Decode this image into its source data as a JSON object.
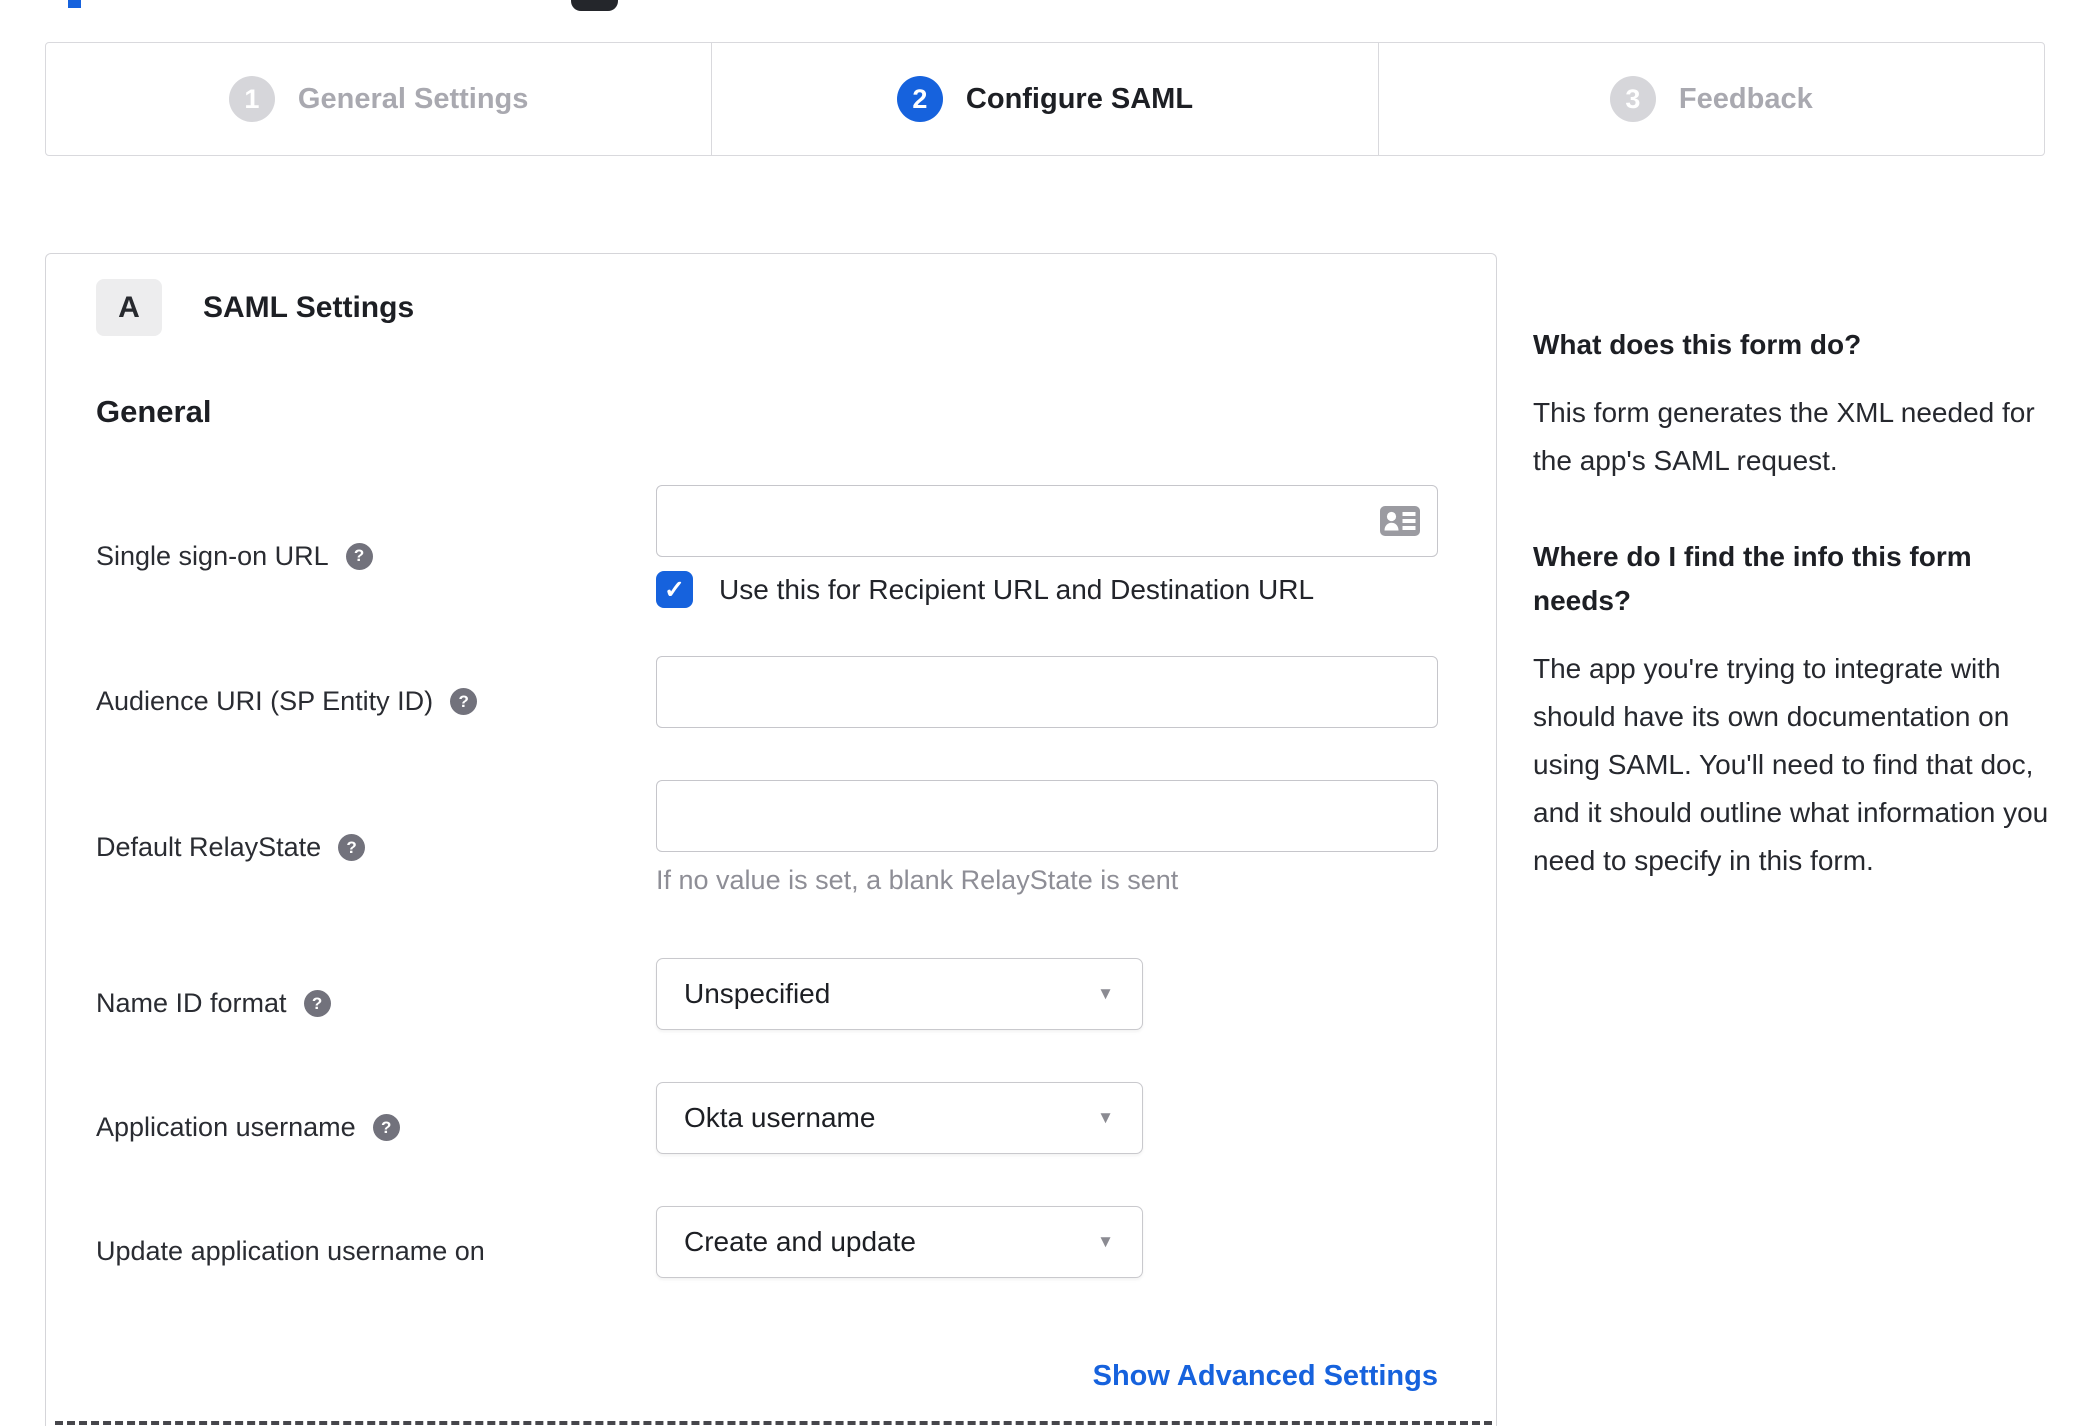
{
  "colors": {
    "accent": "#1662dd",
    "step_inactive": "#d6d6da",
    "hint_gray": "#8e8e96"
  },
  "stepper": {
    "steps": [
      {
        "number": "1",
        "label": "General Settings",
        "state": "inactive"
      },
      {
        "number": "2",
        "label": "Configure SAML",
        "state": "active"
      },
      {
        "number": "3",
        "label": "Feedback",
        "state": "inactive"
      }
    ]
  },
  "panel": {
    "section_badge": "A",
    "section_title": "SAML Settings",
    "group_heading": "General",
    "fields": {
      "sso": {
        "label": "Single sign-on URL",
        "value": "",
        "checkbox_label": "Use this for Recipient URL and Destination URL",
        "checkbox_checked": true
      },
      "audience": {
        "label": "Audience URI (SP Entity ID)",
        "value": ""
      },
      "relay_state": {
        "label": "Default RelayState",
        "value": "",
        "hint": "If no value is set, a blank RelayState is sent"
      },
      "name_id_format": {
        "label": "Name ID format",
        "value": "Unspecified"
      },
      "app_username": {
        "label": "Application username",
        "value": "Okta username"
      },
      "update_app_username": {
        "label": "Update application username on",
        "value": "Create and update"
      }
    },
    "advanced_link": "Show Advanced Settings"
  },
  "sidebar": {
    "q1": "What does this form do?",
    "a1": "This form generates the XML needed for the app's SAML request.",
    "q2": "Where do I find the info this form needs?",
    "a2": "The app you're trying to integrate with should have its own documentation on using SAML. You'll need to find that doc, and it should outline what information you need to specify in this form."
  },
  "icons": {
    "help_glyph": "?",
    "check_glyph": "✓",
    "caret_glyph": "▼"
  }
}
